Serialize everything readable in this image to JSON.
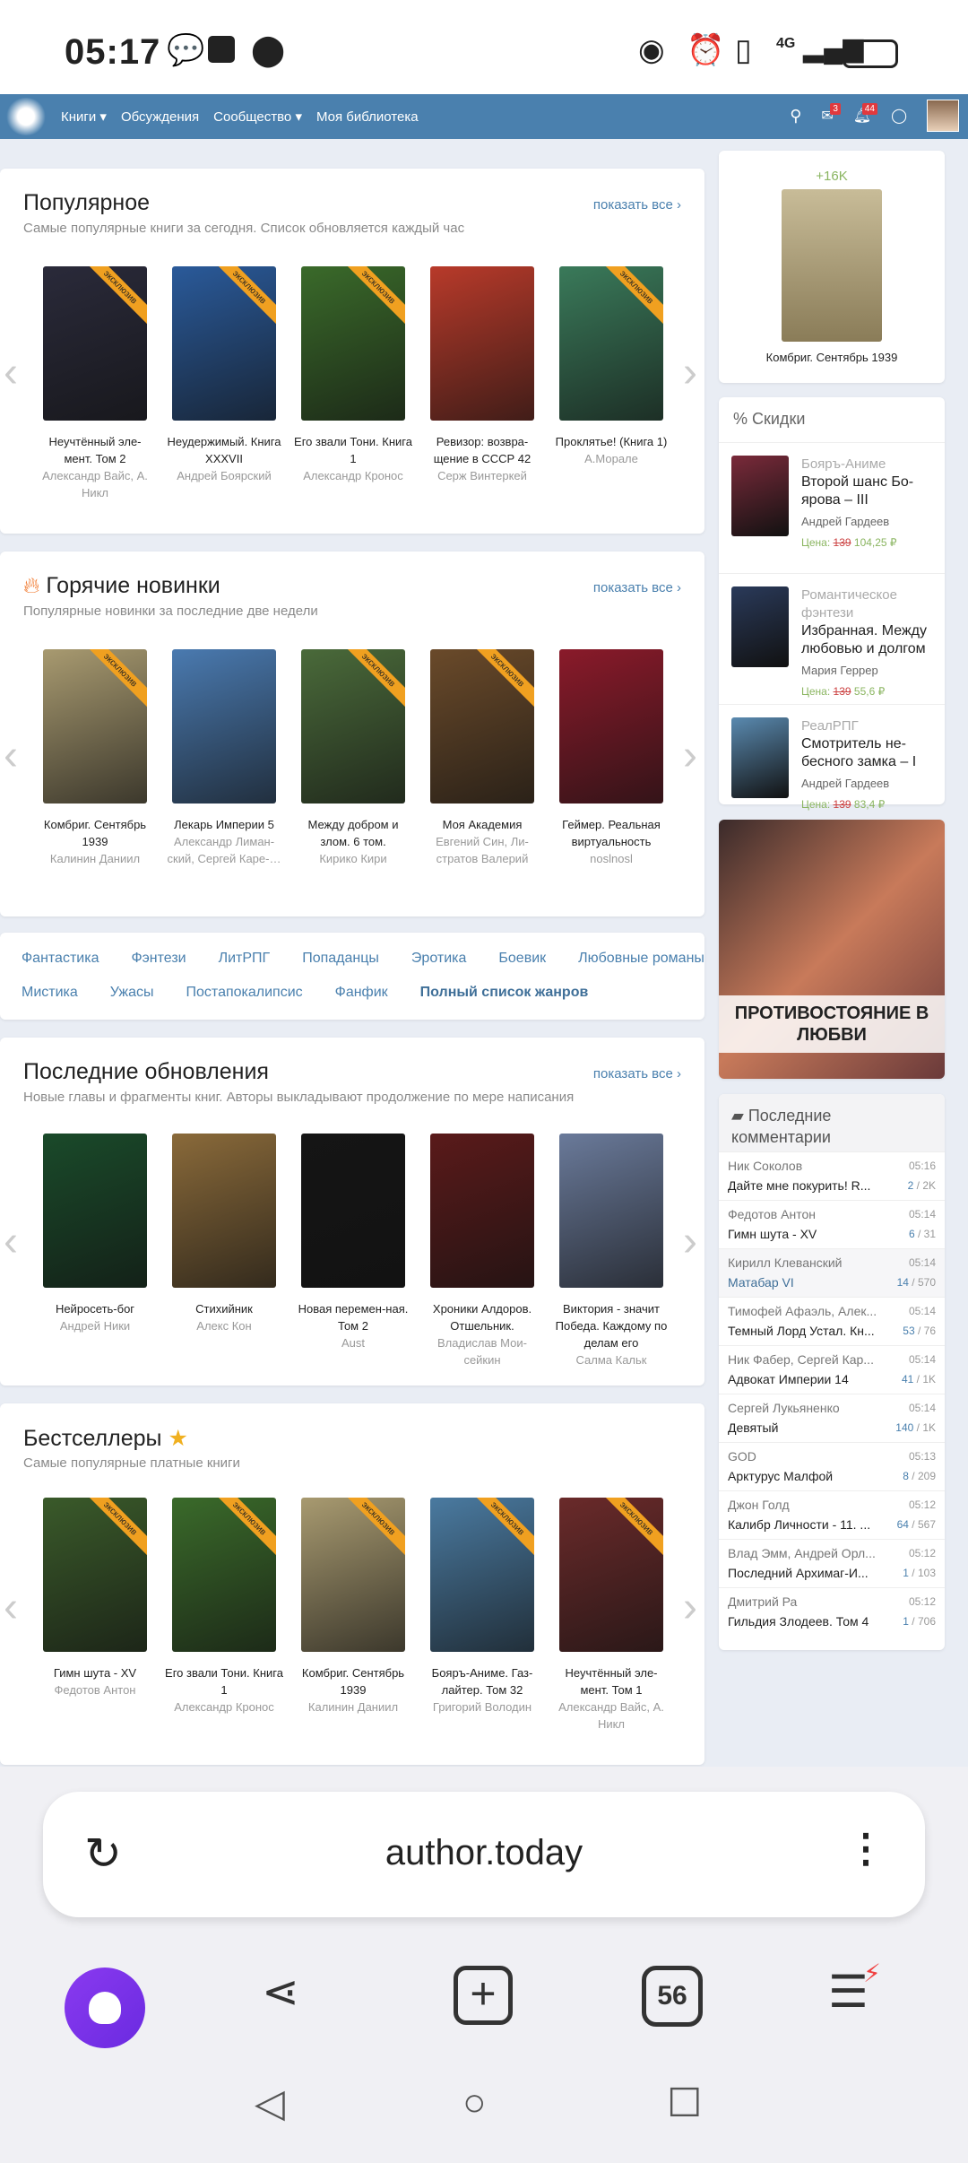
{
  "status_bar": {
    "time": "05:17",
    "network": "4G"
  },
  "nav": {
    "items": [
      "Книги ▾",
      "Обсуждения",
      "Сообщество ▾",
      "Моя библиотека"
    ],
    "messages_badge": "3",
    "notifications_badge": "44"
  },
  "popular": {
    "title": "Популярное",
    "subtitle": "Самые популярные книги за сегодня. Список обновляется каждый час",
    "show_all": "показать все ›",
    "books": [
      {
        "title": "Неучтённый эле-мент. Том 2",
        "author": "Александр Вайс, А. Никл",
        "exclusive": true,
        "color": "#2a2a3a"
      },
      {
        "title": "Неудержимый. Книга XXXVII",
        "author": "Андрей Боярский",
        "exclusive": true,
        "color": "#2a5a9a"
      },
      {
        "title": "Его звали Тони. Книга 1",
        "author": "Александр Кронос",
        "exclusive": true,
        "color": "#3a6a2a"
      },
      {
        "title": "Ревизор: возвра-щение в СССР 42",
        "author": "Серж Винтеркей",
        "exclusive": false,
        "color": "#b83a2a"
      },
      {
        "title": "Проклятье! (Книга 1)",
        "author": "А.Морале",
        "exclusive": true,
        "color": "#3a7a5a"
      }
    ]
  },
  "hot": {
    "title": "Горячие новинки",
    "subtitle": "Популярные новинки за последние две недели",
    "show_all": "показать все ›",
    "books": [
      {
        "title": "Комбриг. Сентябрь 1939",
        "author": "Калинин Даниил",
        "exclusive": true,
        "color": "#a89a70"
      },
      {
        "title": "Лекарь Империи 5",
        "author": "Александр Лиман-ский, Сергей Каре-…",
        "exclusive": false,
        "color": "#4a7ab0"
      },
      {
        "title": "Между добром и злом. 6 том.",
        "author": "Кирико Кири",
        "exclusive": true,
        "color": "#4a6a3a"
      },
      {
        "title": "Моя Академия",
        "author": "Евгений Син, Ли-стратов Валерий",
        "exclusive": true,
        "color": "#6a4a2a"
      },
      {
        "title": "Геймер. Реальная виртуальность",
        "author": "noslnosl",
        "exclusive": false,
        "color": "#8a1a2a"
      }
    ]
  },
  "genres": {
    "items": [
      "Фантастика",
      "Фэнтези",
      "ЛитРПГ",
      "Попаданцы",
      "Эротика",
      "Боевик",
      "Любовные романы",
      "Мистика",
      "Ужасы",
      "Постапокалипсис",
      "Фанфик"
    ],
    "full_list": "Полный список жанров"
  },
  "updates": {
    "title": "Последние обновления",
    "subtitle": "Новые главы и фрагменты книг. Авторы выкладывают продолжение по мере написания",
    "show_all": "показать все ›",
    "books": [
      {
        "title": "Нейросеть-бог",
        "author": "Андрей Ники",
        "exclusive": false,
        "color": "#1a4a2a"
      },
      {
        "title": "Стихийник",
        "author": "Алекс Кон",
        "exclusive": false,
        "color": "#8a6a3a"
      },
      {
        "title": "Новая перемен-ная. Том 2",
        "author": "Aust",
        "exclusive": false,
        "color": "#151515"
      },
      {
        "title": "Хроники Алдоров. Отшельник.",
        "author": "Владислав Мои-сейкин",
        "exclusive": false,
        "color": "#5a1a1a"
      },
      {
        "title": "Виктория - значит Победа. Каждому по делам его",
        "author": "Салма Кальк",
        "exclusive": false,
        "color": "#6a7a9a"
      }
    ]
  },
  "bestsellers": {
    "title": "Бестселлеры",
    "subtitle": "Самые популярные платные книги",
    "books": [
      {
        "title": "Гимн шута - XV",
        "author": "Федотов Антон",
        "exclusive": true,
        "color": "#3a5a2a"
      },
      {
        "title": "Его звали Тони. Книга 1",
        "author": "Александр Кронос",
        "exclusive": true,
        "color": "#3a6a2a"
      },
      {
        "title": "Комбриг. Сентябрь 1939",
        "author": "Калинин Даниил",
        "exclusive": true,
        "color": "#a89a70"
      },
      {
        "title": "Бояръ-Аниме. Газ-лайтер. Том 32",
        "author": "Григорий Володин",
        "exclusive": true,
        "color": "#4a7aa0"
      },
      {
        "title": "Неучтённый эле-мент. Том 1",
        "author": "Александр Вайс, А. Никл",
        "exclusive": true,
        "color": "#6a2a2a"
      }
    ]
  },
  "featured": {
    "count": "+16K",
    "title": "Комбриг. Сентябрь 1939"
  },
  "discounts": {
    "title": "% Скидки",
    "price_label": "Цена:",
    "items": [
      {
        "genre": "Бояръ-Аниме",
        "title": "Второй шанс Бо-ярова – III",
        "author": "Андрей Гардеев",
        "old": "139",
        "new": "104,25 ₽",
        "color": "#7a2a3a"
      },
      {
        "genre": "Романтическое фэнтези",
        "title": "Избранная. Между любовью и долгом",
        "author": "Мария Геррер",
        "old": "139",
        "new": "55,6 ₽",
        "color": "#2a3a5a"
      },
      {
        "genre": "РеалРПГ",
        "title": "Смотритель не-бесного замка – I",
        "author": "Андрей Гардеев",
        "old": "139",
        "new": "83,4 ₽",
        "color": "#5a8ab0"
      }
    ]
  },
  "ad": {
    "text": "ПРОТИВОСТОЯНИЕ В ЛЮБВИ"
  },
  "comments": {
    "title": "Последние комментарии",
    "items": [
      {
        "who": "Ник Соколов",
        "time": "05:16",
        "book": "Дайте мне покурить! R...",
        "new": "2",
        "total": "2K"
      },
      {
        "who": "Федотов Антон",
        "time": "05:14",
        "book": "Гимн шута - XV",
        "new": "6",
        "total": "31"
      },
      {
        "who": "Кирилл Клеванский",
        "time": "05:14",
        "book": "Матабар VI",
        "new": "14",
        "total": "570"
      },
      {
        "who": "Тимофей Афаэль, Алек...",
        "time": "05:14",
        "book": "Темный Лорд Устал. Кн...",
        "new": "53",
        "total": "76"
      },
      {
        "who": "Ник Фабер, Сергей Кар...",
        "time": "05:14",
        "book": "Адвокат Империи 14",
        "new": "41",
        "total": "1K"
      },
      {
        "who": "Сергей Лукьяненко",
        "time": "05:14",
        "book": "Девятый",
        "new": "140",
        "total": "1K"
      },
      {
        "who": "GOD",
        "time": "05:13",
        "book": "Арктурус Малфой",
        "new": "8",
        "total": "209"
      },
      {
        "who": "Джон Голд",
        "time": "05:12",
        "book": "Калибр Личности - 11. ...",
        "new": "64",
        "total": "567"
      },
      {
        "who": "Влад Эмм, Андрей Орл...",
        "time": "05:12",
        "book": "Последний Архимаг-И...",
        "new": "1",
        "total": "103"
      },
      {
        "who": "Дмитрий Ра",
        "time": "05:12",
        "book": "Гильдия Злодеев. Том 4",
        "new": "1",
        "total": "706"
      }
    ]
  },
  "browser": {
    "url": "author.today",
    "tabs_count": "56"
  },
  "exclusive_label": "эксклюзив"
}
